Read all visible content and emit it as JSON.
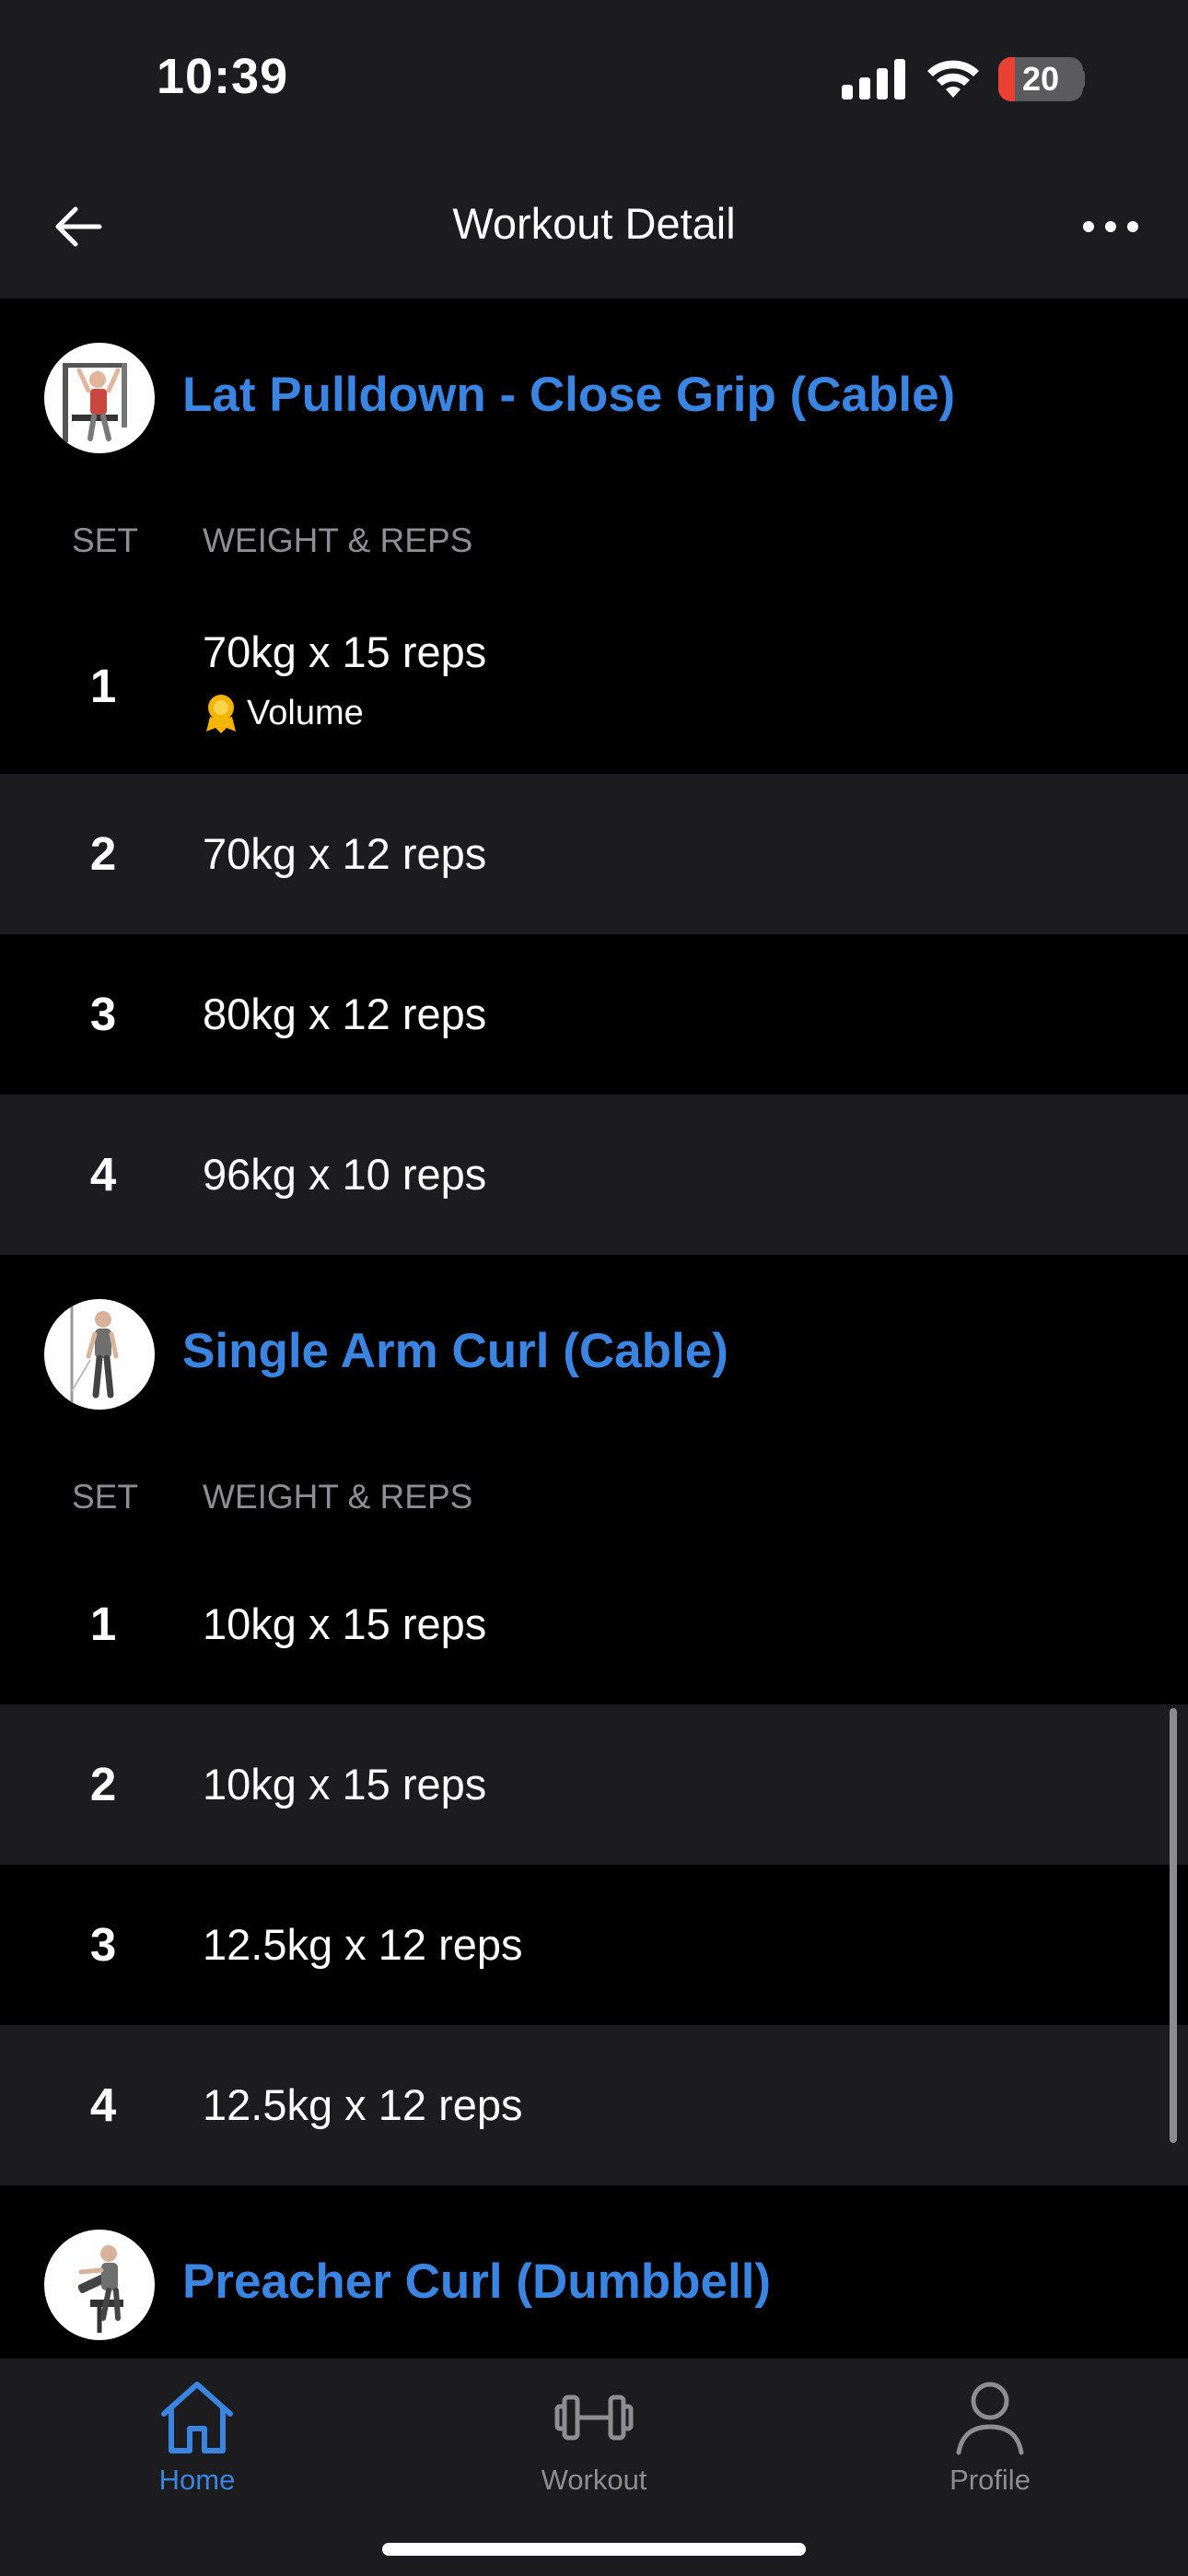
{
  "status": {
    "time": "10:39",
    "battery": "20",
    "battery_level": 0.2
  },
  "nav": {
    "title": "Workout Detail"
  },
  "columns": {
    "set": "SET",
    "weight_reps": "WEIGHT & REPS"
  },
  "exercises": [
    {
      "name": "Lat Pulldown - Close Grip (Cable)",
      "sets": [
        {
          "num": "1",
          "value": "70kg x 15 reps",
          "badge": "Volume"
        },
        {
          "num": "2",
          "value": "70kg x 12 reps"
        },
        {
          "num": "3",
          "value": "80kg x 12 reps"
        },
        {
          "num": "4",
          "value": "96kg x 10 reps"
        }
      ]
    },
    {
      "name": "Single Arm Curl (Cable)",
      "sets": [
        {
          "num": "1",
          "value": "10kg x 15 reps"
        },
        {
          "num": "2",
          "value": "10kg x 15 reps"
        },
        {
          "num": "3",
          "value": "12.5kg x 12 reps"
        },
        {
          "num": "4",
          "value": "12.5kg x 12 reps"
        }
      ]
    },
    {
      "name": "Preacher Curl (Dumbbell)",
      "sets": []
    }
  ],
  "tabs": [
    {
      "label": "Home",
      "icon": "home-icon",
      "active": true
    },
    {
      "label": "Workout",
      "icon": "dumbbell-icon",
      "active": false
    },
    {
      "label": "Profile",
      "icon": "profile-icon",
      "active": false
    }
  ],
  "colors": {
    "accent": "#3a84e2",
    "background": "#000000",
    "surface": "#1c1c1e",
    "muted": "#8d8d92"
  }
}
